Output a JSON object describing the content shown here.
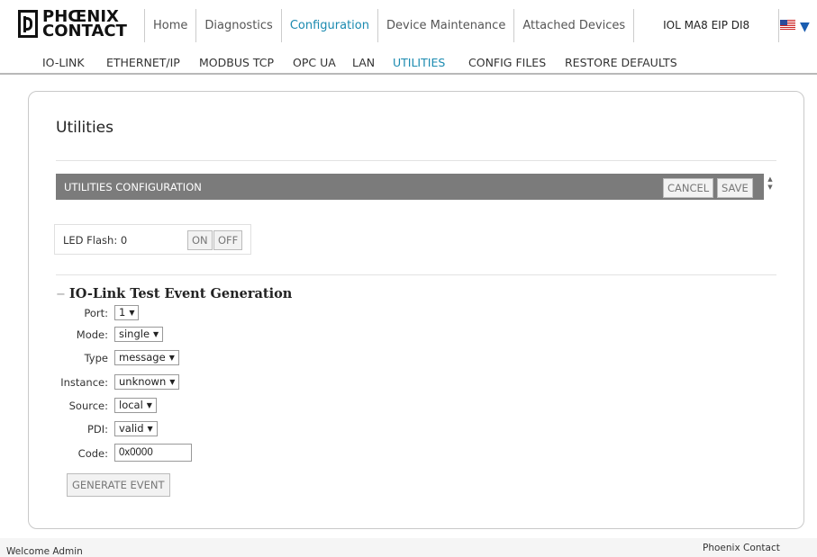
{
  "logo": {
    "word1": "PHŒNIX",
    "word2": "CONTACT"
  },
  "mainnav": {
    "tabs": [
      "Home",
      "Diagnostics",
      "Configuration",
      "Device Maintenance",
      "Attached Devices"
    ],
    "active": "Configuration",
    "device_name": "IOL MA8 EIP DI8"
  },
  "subnav": {
    "items": [
      "IO-LINK",
      "ETHERNET/IP",
      "MODBUS TCP",
      "OPC UA",
      "LAN",
      "UTILITIES",
      "CONFIG FILES",
      "RESTORE DEFAULTS"
    ],
    "active": "UTILITIES"
  },
  "page": {
    "title": "Utilities"
  },
  "utilities_config": {
    "header": "UTILITIES CONFIGURATION",
    "cancel_label": "CANCEL",
    "save_label": "SAVE"
  },
  "led_flash": {
    "label": "LED Flash: 0",
    "on_label": "ON",
    "off_label": "OFF"
  },
  "test_event": {
    "title": "IO-Link Test Event Generation",
    "collapse_symbol": "−",
    "fields": {
      "port": {
        "label": "Port:",
        "value": "1"
      },
      "mode": {
        "label": "Mode:",
        "value": "single"
      },
      "type": {
        "label": "Type",
        "value": "message"
      },
      "instance": {
        "label": "Instance:",
        "value": "unknown"
      },
      "source": {
        "label": "Source:",
        "value": "local"
      },
      "pdi": {
        "label": "PDI:",
        "value": "valid"
      },
      "code": {
        "label": "Code:",
        "value": "0x0000"
      }
    },
    "generate_label": "GENERATE EVENT"
  },
  "footer": {
    "welcome": "Welcome Admin",
    "brand": "Phoenix Contact"
  },
  "icons": {
    "language": "us-flag-icon",
    "dropdown": "caret-down-icon"
  }
}
